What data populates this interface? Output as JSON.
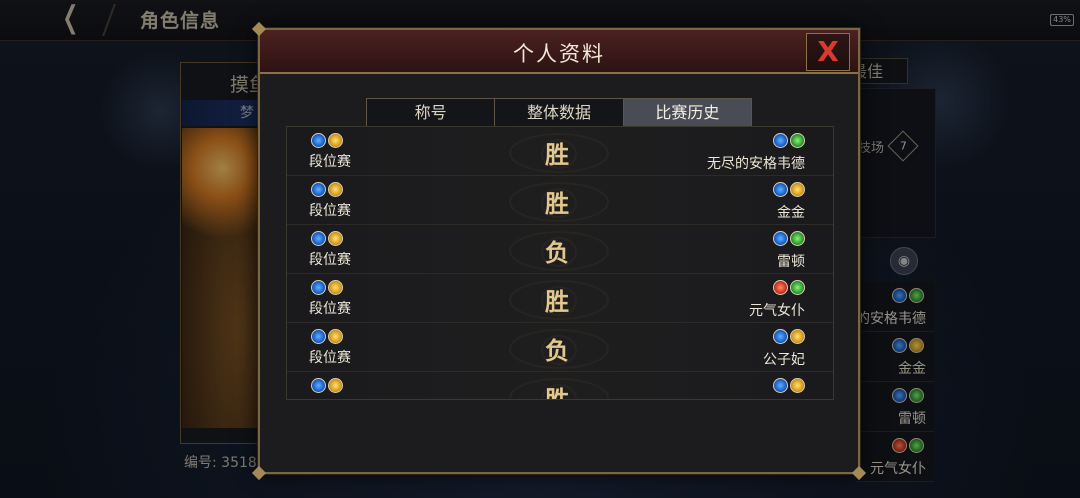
{
  "background": {
    "header_title": "角色信息",
    "battery": "43%",
    "left_tab": "摸鱼",
    "left_sub": "梦",
    "serial": "编号: 3518",
    "right_tab": "最佳",
    "arena_label": "技场",
    "arena_count": "7",
    "right_list": [
      {
        "icons": [
          "blue",
          "green"
        ],
        "name": "的安格韦德"
      },
      {
        "icons": [
          "blue",
          "gold"
        ],
        "name": "金金"
      },
      {
        "icons": [
          "blue",
          "green"
        ],
        "name": "雷顿"
      },
      {
        "icons": [
          "red",
          "green"
        ],
        "name": "元气女仆"
      }
    ]
  },
  "modal": {
    "title": "个人资料",
    "close": "X",
    "tabs": [
      "称号",
      "整体数据",
      "比赛历史"
    ],
    "active_tab": 2,
    "matches": [
      {
        "mode": "段位赛",
        "mode_icons": [
          "blue",
          "gold"
        ],
        "result": "胜",
        "hero_icons": [
          "blue",
          "green"
        ],
        "hero": "无尽的安格韦德"
      },
      {
        "mode": "段位赛",
        "mode_icons": [
          "blue",
          "gold"
        ],
        "result": "胜",
        "hero_icons": [
          "blue",
          "gold"
        ],
        "hero": "金金"
      },
      {
        "mode": "段位赛",
        "mode_icons": [
          "blue",
          "gold"
        ],
        "result": "负",
        "hero_icons": [
          "blue",
          "green"
        ],
        "hero": "雷顿"
      },
      {
        "mode": "段位赛",
        "mode_icons": [
          "blue",
          "gold"
        ],
        "result": "胜",
        "hero_icons": [
          "red",
          "green"
        ],
        "hero": "元气女仆"
      },
      {
        "mode": "段位赛",
        "mode_icons": [
          "blue",
          "gold"
        ],
        "result": "负",
        "hero_icons": [
          "blue",
          "gold"
        ],
        "hero": "公子妃"
      },
      {
        "mode": "",
        "mode_icons": [
          "blue",
          "gold"
        ],
        "result": "胜",
        "hero_icons": [
          "blue",
          "gold"
        ],
        "hero": ""
      }
    ]
  }
}
